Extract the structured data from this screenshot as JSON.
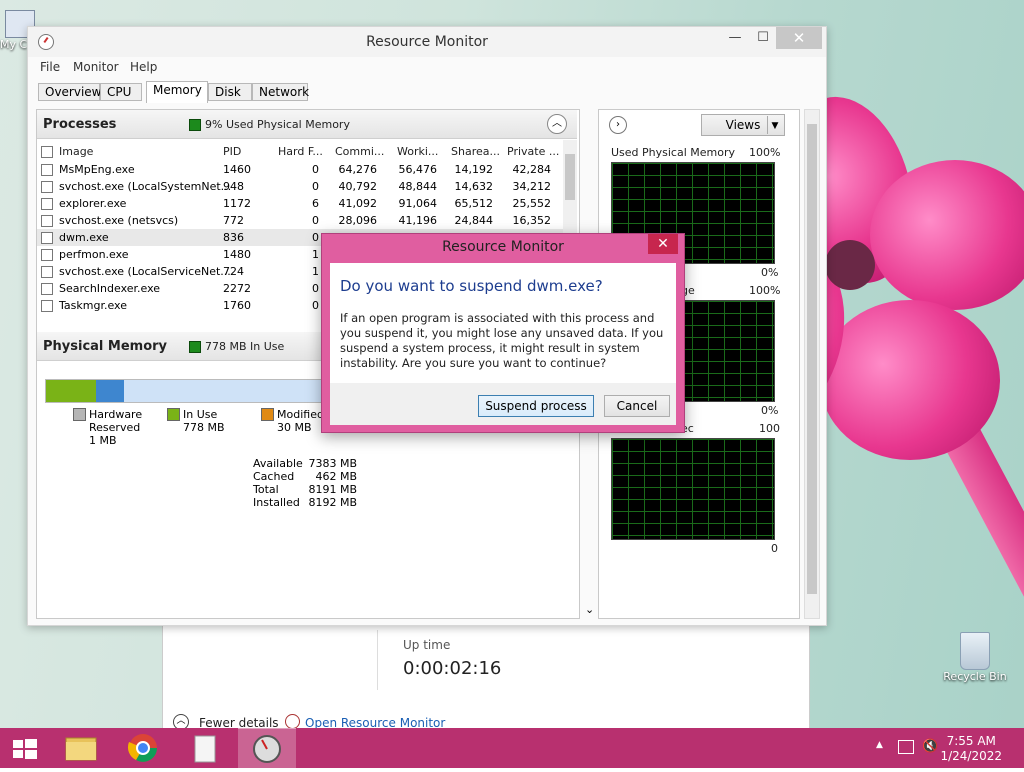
{
  "desktop": {
    "icon_top_left_label": "My C",
    "recycle_bin_label": "Recycle Bin"
  },
  "taskmgr": {
    "uptime_label": "Up time",
    "uptime_value": "0:00:02:16",
    "fewer_details": "Fewer details",
    "open_resource_monitor": "Open Resource Monitor"
  },
  "window": {
    "title": "Resource Monitor",
    "minimize": "—",
    "maximize": "☐",
    "close": "✕",
    "menu": [
      "File",
      "Monitor",
      "Help"
    ],
    "tabs": [
      "Overview",
      "CPU",
      "Memory",
      "Disk",
      "Network"
    ],
    "active_tab": "Memory"
  },
  "processes": {
    "title": "Processes",
    "info": "9% Used Physical Memory",
    "columns": [
      "Image",
      "PID",
      "Hard F...",
      "Commi...",
      "Worki...",
      "Sharea...",
      "Private ..."
    ],
    "rows": [
      {
        "image": "MsMpEng.exe",
        "pid": "1460",
        "hard": "0",
        "commit": "64,276",
        "working": "56,476",
        "shareable": "14,192",
        "private": "42,284"
      },
      {
        "image": "svchost.exe (LocalSystemNet...",
        "pid": "948",
        "hard": "0",
        "commit": "40,792",
        "working": "48,844",
        "shareable": "14,632",
        "private": "34,212"
      },
      {
        "image": "explorer.exe",
        "pid": "1172",
        "hard": "6",
        "commit": "41,092",
        "working": "91,064",
        "shareable": "65,512",
        "private": "25,552"
      },
      {
        "image": "svchost.exe (netsvcs)",
        "pid": "772",
        "hard": "0",
        "commit": "28,096",
        "working": "41,196",
        "shareable": "24,844",
        "private": "16,352"
      },
      {
        "image": "dwm.exe",
        "pid": "836",
        "hard": "0",
        "commit": "",
        "working": "",
        "shareable": "",
        "private": ""
      },
      {
        "image": "perfmon.exe",
        "pid": "1480",
        "hard": "1",
        "commit": "",
        "working": "",
        "shareable": "",
        "private": ""
      },
      {
        "image": "svchost.exe (LocalServiceNet...",
        "pid": "724",
        "hard": "1",
        "commit": "",
        "working": "",
        "shareable": "",
        "private": ""
      },
      {
        "image": "SearchIndexer.exe",
        "pid": "2272",
        "hard": "0",
        "commit": "",
        "working": "",
        "shareable": "",
        "private": ""
      },
      {
        "image": "Taskmgr.exe",
        "pid": "1760",
        "hard": "0",
        "commit": "",
        "working": "",
        "shareable": "",
        "private": ""
      }
    ]
  },
  "physical_memory": {
    "title": "Physical Memory",
    "info": "778 MB In Use",
    "legend": [
      {
        "label": "Hardware Reserved",
        "value": "1 MB",
        "color": "#b5b5b5"
      },
      {
        "label": "In Use",
        "value": "778 MB",
        "color": "#7ab317"
      },
      {
        "label": "Modified",
        "value": "30 MB",
        "color": "#e08a14"
      }
    ],
    "stats": [
      {
        "label": "Available",
        "value": "7383 MB"
      },
      {
        "label": "Cached",
        "value": "462 MB"
      },
      {
        "label": "Total",
        "value": "8191 MB"
      },
      {
        "label": "Installed",
        "value": "8192 MB"
      }
    ]
  },
  "graphs": {
    "views_label": "Views",
    "g1_title": "Used Physical Memory",
    "g1_max": "100%",
    "g1_min": "0%",
    "g2_title": "ge",
    "g2_max": "100%",
    "g2_min": "0%",
    "g3_title": "ec",
    "g3_max": "100",
    "g3_min": "0"
  },
  "dialog": {
    "title": "Resource Monitor",
    "close": "✕",
    "heading": "Do you want to suspend dwm.exe?",
    "message": "If an open program is associated with this process and you suspend it, you might lose any unsaved data. If you suspend a system process, it might result in system instability. Are you sure you want to continue?",
    "primary_button": "Suspend process",
    "cancel_button": "Cancel"
  },
  "taskbar": {
    "time": "7:55 AM",
    "date": "1/24/2022"
  },
  "colors": {
    "taskbar": "#b8306f",
    "dialog_frame": "#e05ea0",
    "heading_blue": "#1d3d8f"
  }
}
